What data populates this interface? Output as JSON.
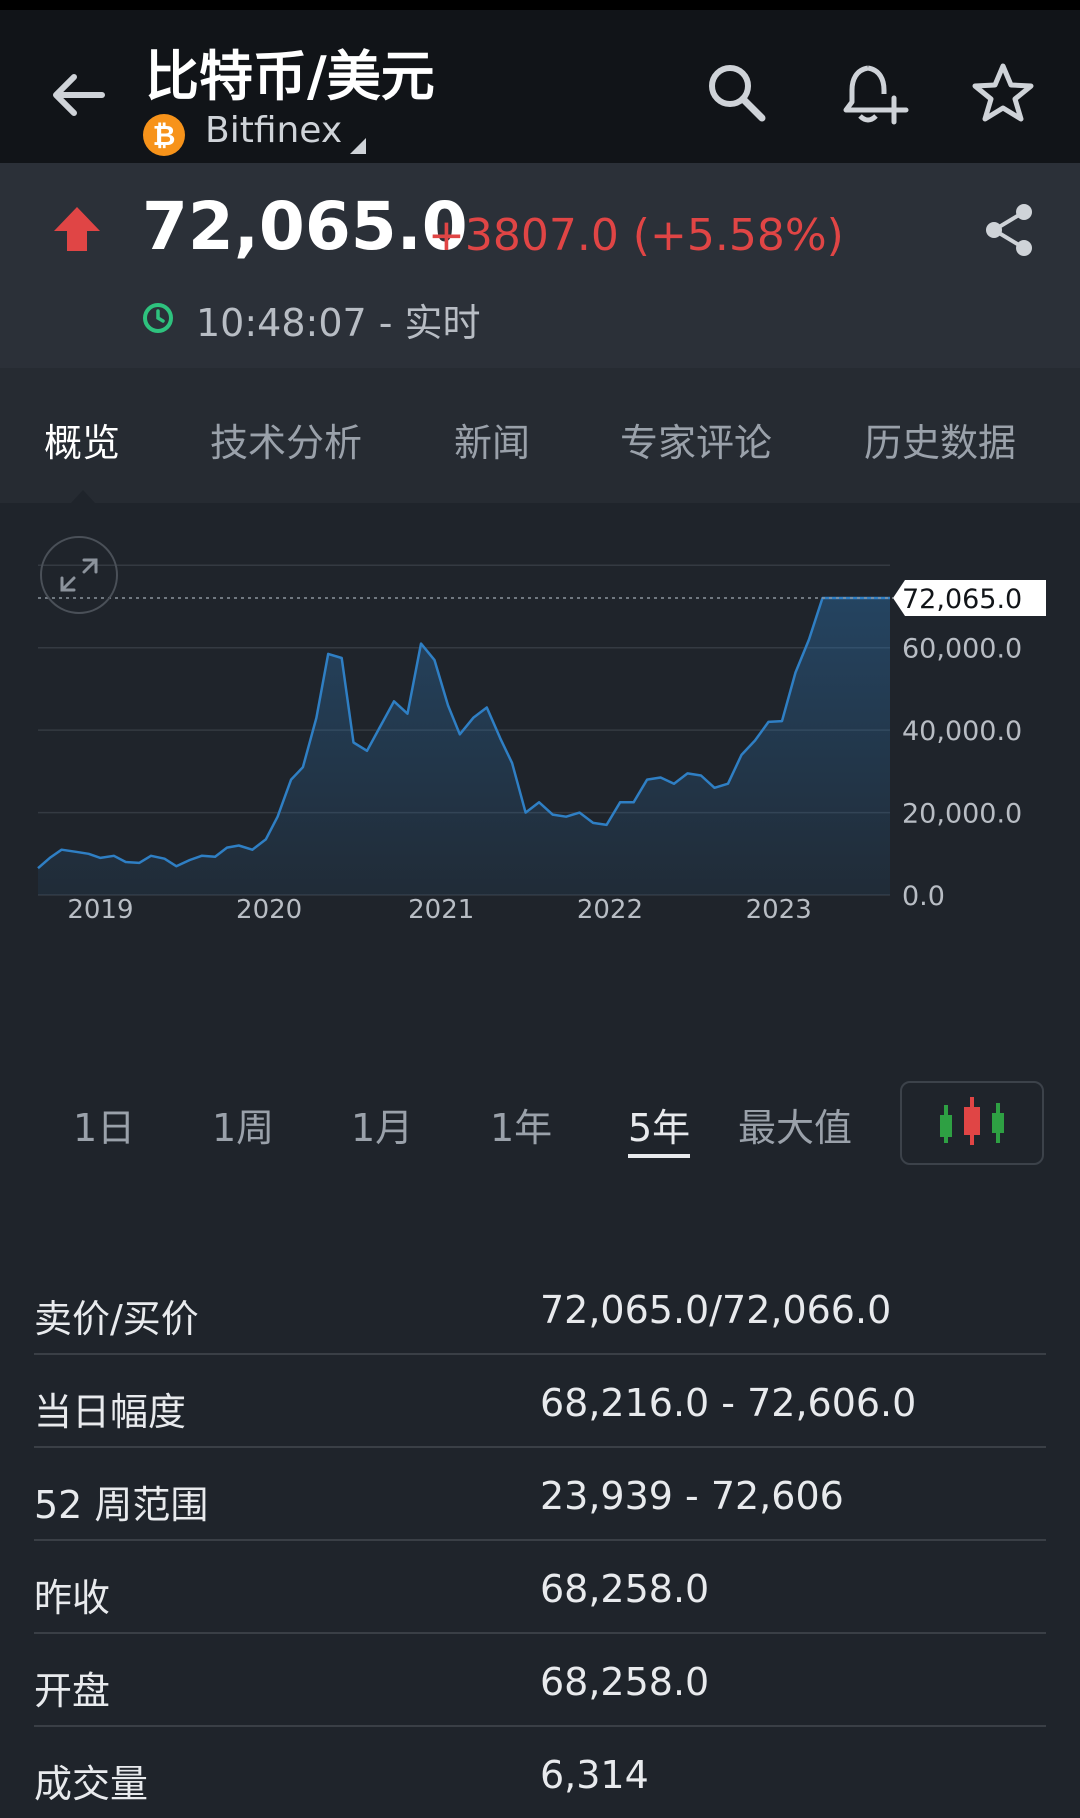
{
  "header": {
    "title": "比特币/美元",
    "coin_symbol": "₿",
    "exchange": "Bitfinex"
  },
  "quote": {
    "price": "72,065.0",
    "change": "+3807.0 (+5.58%)",
    "time": "10:48:07 - 实时",
    "up_color": "#e04545",
    "live_color": "#2ec27e"
  },
  "tabs": [
    {
      "label": "概览",
      "active": true
    },
    {
      "label": "技术分析"
    },
    {
      "label": "新闻"
    },
    {
      "label": "专家评论"
    },
    {
      "label": "历史数据"
    }
  ],
  "chart_data": {
    "type": "area",
    "x_tick_labels": [
      "2019",
      "2020",
      "2021",
      "2022",
      "2023"
    ],
    "y_tick_labels": [
      "0.0",
      "20,000.0",
      "40,000.0",
      "60,000.0"
    ],
    "ylim": [
      0,
      80000
    ],
    "current_value_label": "72,065.0",
    "current_value": 72065,
    "line_color": "#2f7fc4",
    "series": [
      {
        "x": [
          2018.83,
          2018.9,
          2018.97,
          2019.05,
          2019.13,
          2019.2,
          2019.28,
          2019.35,
          2019.43,
          2019.5,
          2019.58,
          2019.65,
          2019.73,
          2019.8,
          2019.88,
          2019.95,
          2020.02,
          2020.1,
          2020.18,
          2020.25,
          2020.33,
          2020.4,
          2020.48,
          2020.55,
          2020.63,
          2020.7,
          2020.78,
          2020.86,
          2020.94,
          2021.02,
          2021.1,
          2021.18,
          2021.26,
          2021.33,
          2021.41,
          2021.49,
          2021.57,
          2021.64,
          2021.72,
          2021.8,
          2021.88,
          2021.96,
          2022.04,
          2022.12,
          2022.2,
          2022.28,
          2022.36,
          2022.44,
          2022.52,
          2022.6,
          2022.68,
          2022.76,
          2022.84,
          2022.92,
          2023.0,
          2023.08,
          2023.16,
          2023.24,
          2023.32,
          2023.4,
          2023.48,
          2023.56,
          2023.64,
          2023.72,
          2023.78,
          2023.84,
          2023.88
        ],
        "y": [
          6500,
          9000,
          11000,
          10500,
          10000,
          9000,
          9500,
          8000,
          7800,
          9500,
          8800,
          7000,
          8500,
          9500,
          9300,
          11500,
          12000,
          11000,
          13500,
          19000,
          28000,
          31000,
          43000,
          58500,
          57500,
          37000,
          35000,
          41000,
          47000,
          44000,
          61000,
          57000,
          46000,
          39000,
          43000,
          45500,
          38000,
          32000,
          20000,
          22500,
          19500,
          19000,
          20000,
          17500,
          17000,
          22500,
          22500,
          28000,
          28500,
          27000,
          29500,
          29000,
          26000,
          27000,
          34000,
          37500,
          42000,
          42200,
          54000,
          62000,
          72065,
          72065,
          72065,
          72065,
          72065,
          72065,
          72065
        ]
      }
    ]
  },
  "ranges": [
    {
      "label": "1日"
    },
    {
      "label": "1周"
    },
    {
      "label": "1月"
    },
    {
      "label": "1年"
    },
    {
      "label": "5年",
      "active": true
    },
    {
      "label": "最大值"
    }
  ],
  "stats": [
    {
      "label": "卖价/买价",
      "value": "72,065.0/72,066.0"
    },
    {
      "label": "当日幅度",
      "value": "68,216.0 - 72,606.0"
    },
    {
      "label": "52 周范围",
      "value": "23,939 - 72,606"
    },
    {
      "label": "昨收",
      "value": "68,258.0"
    },
    {
      "label": "开盘",
      "value": "68,258.0"
    },
    {
      "label": "成交量",
      "value": "6,314"
    }
  ],
  "icons": {
    "back": "arrow-left-icon",
    "search": "search-icon",
    "alert": "bell-plus-icon",
    "star": "star-icon",
    "share": "share-icon",
    "expand": "expand-icon",
    "candles": "candlestick-icon"
  }
}
